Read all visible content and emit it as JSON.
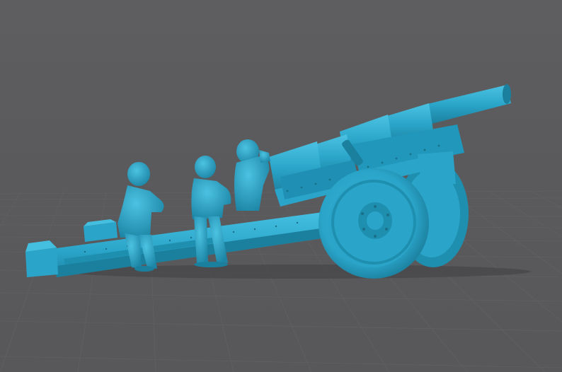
{
  "viewer": {
    "background_color": "#5b5b5d",
    "grid_color": "#6a6a6d",
    "model_color": "#2aa5c9",
    "model_shadow_color": "#1b7f9e",
    "model_highlight_color": "#4cc2e2",
    "floor_shadow_color": "#3f3f41"
  },
  "scene": {
    "model_name": "",
    "objects": [
      {
        "name": "howitzer-cannon"
      },
      {
        "name": "crew-figure-1"
      },
      {
        "name": "crew-figure-2"
      },
      {
        "name": "crew-figure-3"
      },
      {
        "name": "ammo-crate"
      }
    ]
  }
}
